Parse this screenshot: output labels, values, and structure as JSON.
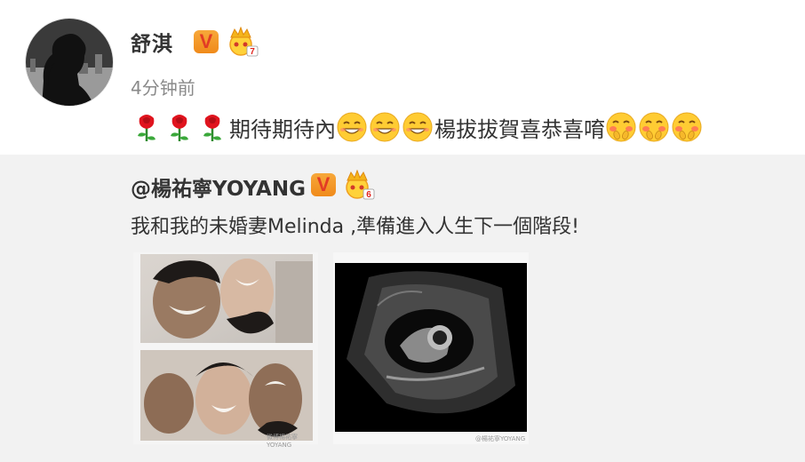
{
  "post": {
    "username": "舒淇",
    "timestamp": "4分钟前",
    "text": "期待期待內",
    "text2": "楊拔拔賀喜恭喜唷"
  },
  "icons": {
    "verified": "verified-v-badge-icon",
    "crown": "vip-crown-icon",
    "rose": "rose-emoji-icon",
    "grin": "grin-emoji-icon",
    "blush": "shy-emoji-icon"
  },
  "badges": {
    "crown_level_user": "7",
    "crown_level_repost": "6"
  },
  "repost": {
    "user": "@楊祐寧YOYANG",
    "text": "我和我的未婚妻Melinda ,準備進入人生下一個階段!",
    "watermark1": "微博楊祐寧YOYANG",
    "watermark2": "@楊祐寧YOYANG"
  },
  "colors": {
    "repost_bg": "#f2f2f2",
    "badge_orange": "#f5961f",
    "text": "#333333",
    "muted": "#8a8a8a"
  }
}
